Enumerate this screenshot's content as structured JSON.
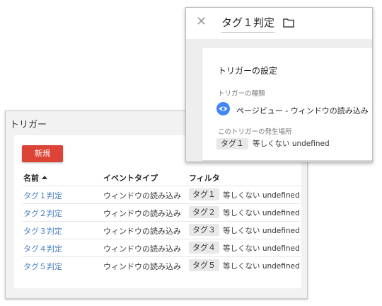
{
  "trigger_list": {
    "title": "トリガー",
    "new_button": "新規",
    "columns": {
      "name": "名前",
      "type": "イベントタイプ",
      "filter": "フィルタ"
    },
    "rows": [
      {
        "name": "タグ１判定",
        "type": "ウィンドウの読み込み",
        "variable": "タグ１",
        "condition": "等しくない undefined"
      },
      {
        "name": "タグ２判定",
        "type": "ウィンドウの読み込み",
        "variable": "タグ２",
        "condition": "等しくない undefined"
      },
      {
        "name": "タグ３判定",
        "type": "ウィンドウの読み込み",
        "variable": "タグ３",
        "condition": "等しくない undefined"
      },
      {
        "name": "タグ４判定",
        "type": "ウィンドウの読み込み",
        "variable": "タグ４",
        "condition": "等しくない undefined"
      },
      {
        "name": "タグ５判定",
        "type": "ウィンドウの読み込み",
        "variable": "タグ５",
        "condition": "等しくない undefined"
      }
    ]
  },
  "detail": {
    "tag_name": "タグ１判定",
    "close_icon": "close-icon",
    "folder_icon": "folder-icon",
    "card_title": "トリガーの設定",
    "type_label": "トリガーの種類",
    "trigger_type": "ページビュー - ウィンドウの読み込み",
    "where_label": "このトリガーの発生場所",
    "variable": "タグ１",
    "condition": "等しくない undefined",
    "accent_color": "#4285f4"
  },
  "colors": {
    "new_button": "#db4437",
    "link": "#4a7fc1"
  }
}
